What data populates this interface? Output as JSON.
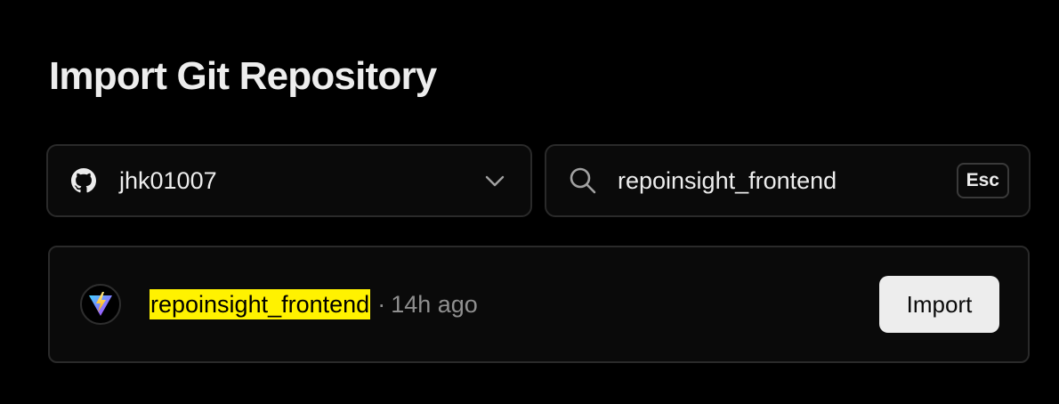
{
  "page": {
    "title": "Import Git Repository"
  },
  "account_select": {
    "provider_icon": "github-icon",
    "selected": "jhk01007",
    "chevron_icon": "chevron-down-icon"
  },
  "search": {
    "icon": "search-icon",
    "value": "repoinsight_frontend",
    "esc_label": "Esc"
  },
  "repositories": [
    {
      "icon": "vite-icon",
      "name": "repoinsight_frontend",
      "separator": "·",
      "updated": "14h ago",
      "action_label": "Import"
    }
  ],
  "colors": {
    "background": "#000000",
    "surface": "#0a0a0a",
    "border": "#2a2a2a",
    "highlight": "#fff200",
    "button_bg": "#ededed",
    "muted_text": "#8f8f8f"
  }
}
